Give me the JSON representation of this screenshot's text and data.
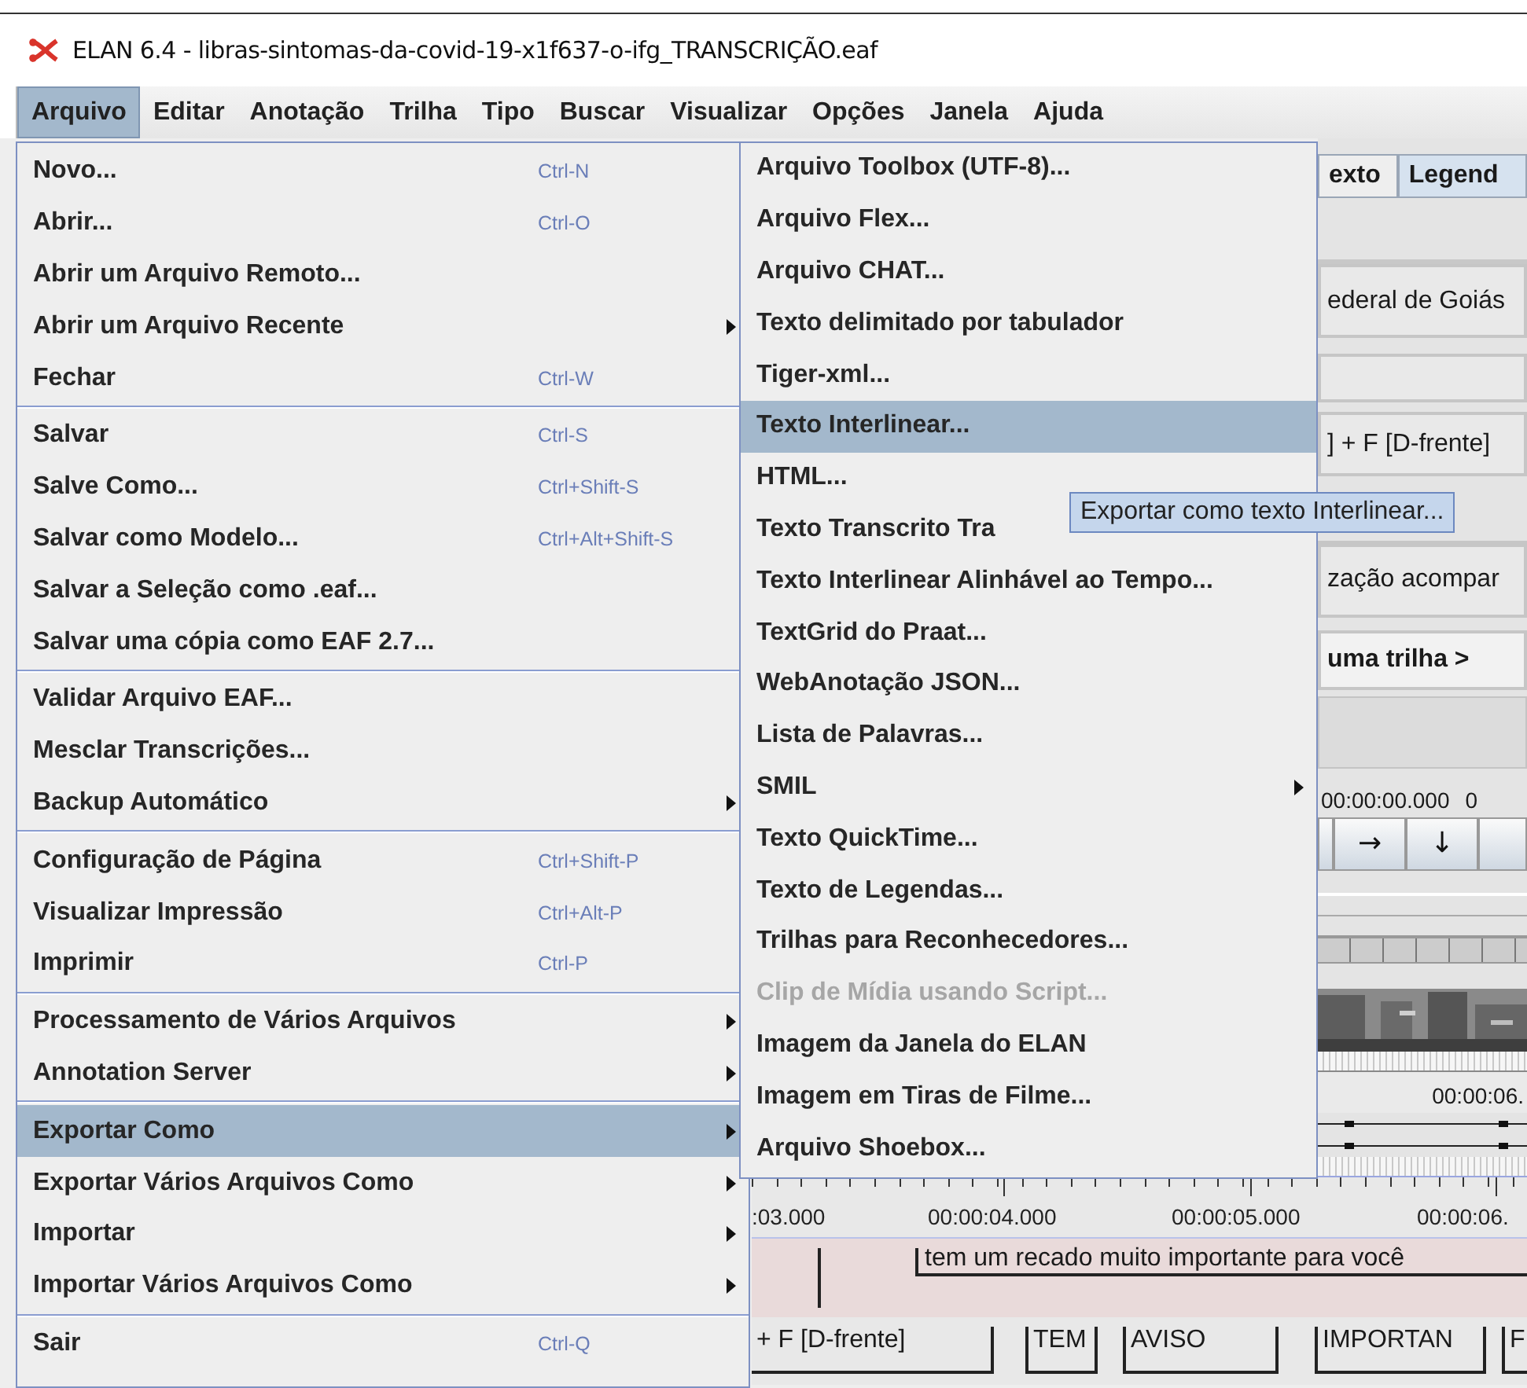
{
  "window": {
    "title": "ELAN 6.4 - libras-sintomas-da-covid-19-x1f637-o-ifg_TRANSCRIÇÃO.eaf"
  },
  "menubar": [
    {
      "label": "Arquivo",
      "selected": true
    },
    {
      "label": "Editar",
      "selected": false
    },
    {
      "label": "Anotação",
      "selected": false
    },
    {
      "label": "Trilha",
      "selected": false
    },
    {
      "label": "Tipo",
      "selected": false
    },
    {
      "label": "Buscar",
      "selected": false
    },
    {
      "label": "Visualizar",
      "selected": false
    },
    {
      "label": "Opções",
      "selected": false
    },
    {
      "label": "Janela",
      "selected": false
    },
    {
      "label": "Ajuda",
      "selected": false
    }
  ],
  "file_menu": {
    "groups": [
      {
        "items": [
          {
            "label": "Novo...",
            "shortcut": "Ctrl-N",
            "submenu": false,
            "selected": false
          },
          {
            "label": "Abrir...",
            "shortcut": "Ctrl-O",
            "submenu": false,
            "selected": false
          },
          {
            "label": "Abrir um Arquivo Remoto...",
            "submenu": false,
            "selected": false
          },
          {
            "label": "Abrir um Arquivo Recente",
            "submenu": true,
            "selected": false
          },
          {
            "label": "Fechar",
            "shortcut": "Ctrl-W",
            "submenu": false,
            "selected": false
          }
        ]
      },
      {
        "items": [
          {
            "label": "Salvar",
            "shortcut": "Ctrl-S",
            "submenu": false,
            "selected": false
          },
          {
            "label": "Salve Como...",
            "shortcut": "Ctrl+Shift-S",
            "submenu": false,
            "selected": false
          },
          {
            "label": "Salvar como Modelo...",
            "shortcut": "Ctrl+Alt+Shift-S",
            "submenu": false,
            "selected": false
          },
          {
            "label": "Salvar a Seleção como .eaf...",
            "submenu": false,
            "selected": false
          },
          {
            "label": "Salvar uma cópia como EAF 2.7...",
            "submenu": false,
            "selected": false
          }
        ]
      },
      {
        "items": [
          {
            "label": "Validar Arquivo EAF...",
            "submenu": false,
            "selected": false
          },
          {
            "label": "Mesclar Transcrições...",
            "submenu": false,
            "selected": false
          },
          {
            "label": "Backup Automático",
            "submenu": true,
            "selected": false
          }
        ]
      },
      {
        "items": [
          {
            "label": "Configuração de Página",
            "shortcut": "Ctrl+Shift-P",
            "submenu": false,
            "selected": false
          },
          {
            "label": "Visualizar Impressão",
            "shortcut": "Ctrl+Alt-P",
            "submenu": false,
            "selected": false
          },
          {
            "label": "Imprimir",
            "shortcut": "Ctrl-P",
            "submenu": false,
            "selected": false
          }
        ]
      },
      {
        "items": [
          {
            "label": "Processamento de Vários Arquivos",
            "submenu": true,
            "selected": false
          },
          {
            "label": "Annotation Server",
            "submenu": true,
            "selected": false
          }
        ]
      },
      {
        "items": [
          {
            "label": "Exportar Como",
            "submenu": true,
            "selected": true
          },
          {
            "label": "Exportar Vários Arquivos Como",
            "submenu": true,
            "selected": false
          },
          {
            "label": "Importar",
            "submenu": true,
            "selected": false
          },
          {
            "label": "Importar Vários Arquivos Como",
            "submenu": true,
            "selected": false
          }
        ]
      },
      {
        "items": [
          {
            "label": "Sair",
            "shortcut": "Ctrl-Q",
            "submenu": false,
            "selected": false
          }
        ]
      }
    ]
  },
  "export_submenu": {
    "items": [
      {
        "label": "Arquivo Toolbox (UTF-8)...",
        "submenu": false,
        "selected": false,
        "disabled": false
      },
      {
        "label": "Arquivo Flex...",
        "submenu": false,
        "selected": false,
        "disabled": false
      },
      {
        "label": "Arquivo CHAT...",
        "submenu": false,
        "selected": false,
        "disabled": false
      },
      {
        "label": "Texto delimitado por tabulador",
        "submenu": false,
        "selected": false,
        "disabled": false
      },
      {
        "label": "Tiger-xml...",
        "submenu": false,
        "selected": false,
        "disabled": false
      },
      {
        "label": "Texto Interlinear...",
        "submenu": false,
        "selected": true,
        "disabled": false
      },
      {
        "label": "HTML...",
        "submenu": false,
        "selected": false,
        "disabled": false
      },
      {
        "label": "Texto Transcrito Tra",
        "submenu": false,
        "selected": false,
        "disabled": false
      },
      {
        "label": "Texto Interlinear Alinhável ao Tempo...",
        "submenu": false,
        "selected": false,
        "disabled": false
      },
      {
        "label": "TextGrid do Praat...",
        "submenu": false,
        "selected": false,
        "disabled": false
      },
      {
        "label": "WebAnotação JSON...",
        "submenu": false,
        "selected": false,
        "disabled": false
      },
      {
        "label": "Lista de Palavras...",
        "submenu": false,
        "selected": false,
        "disabled": false
      },
      {
        "label": "SMIL",
        "submenu": true,
        "selected": false,
        "disabled": false
      },
      {
        "label": "Texto QuickTime...",
        "submenu": false,
        "selected": false,
        "disabled": false
      },
      {
        "label": "Texto de Legendas...",
        "submenu": false,
        "selected": false,
        "disabled": false
      },
      {
        "label": "Trilhas para Reconhecedores...",
        "submenu": false,
        "selected": false,
        "disabled": false
      },
      {
        "label": "Clip de Mídia usando Script...",
        "submenu": false,
        "selected": false,
        "disabled": true
      },
      {
        "label": "Imagem da Janela do ELAN",
        "submenu": false,
        "selected": false,
        "disabled": false
      },
      {
        "label": "Imagem em Tiras de Filme...",
        "submenu": false,
        "selected": false,
        "disabled": false
      },
      {
        "label": "Arquivo Shoebox...",
        "submenu": false,
        "selected": false,
        "disabled": false
      }
    ]
  },
  "tooltip": "Exportar como texto Interlinear...",
  "side_panel": {
    "tabs": [
      {
        "label": "exto",
        "selected": false
      },
      {
        "label": "Legend",
        "selected": true
      }
    ],
    "field_1": "ederal de Goiás",
    "field_2": "] + F [D-frente]",
    "field_3": "zação acompar",
    "tier_selector": "uma trilha >",
    "time_readout": "00:00:00.000",
    "column_2": "0",
    "nav_buttons": [
      "→",
      "↓"
    ],
    "ruler_label": "00:00:06."
  },
  "timeline": {
    "ruler": [
      ":03.000",
      "00:00:04.000",
      "00:00:05.000",
      "00:00:06."
    ],
    "annotation": "tem um recado muito importante para você",
    "gloss_tier": [
      "+ F [D-frente]",
      "TEM",
      "AVISO",
      "IMPORTAN",
      "F"
    ]
  }
}
